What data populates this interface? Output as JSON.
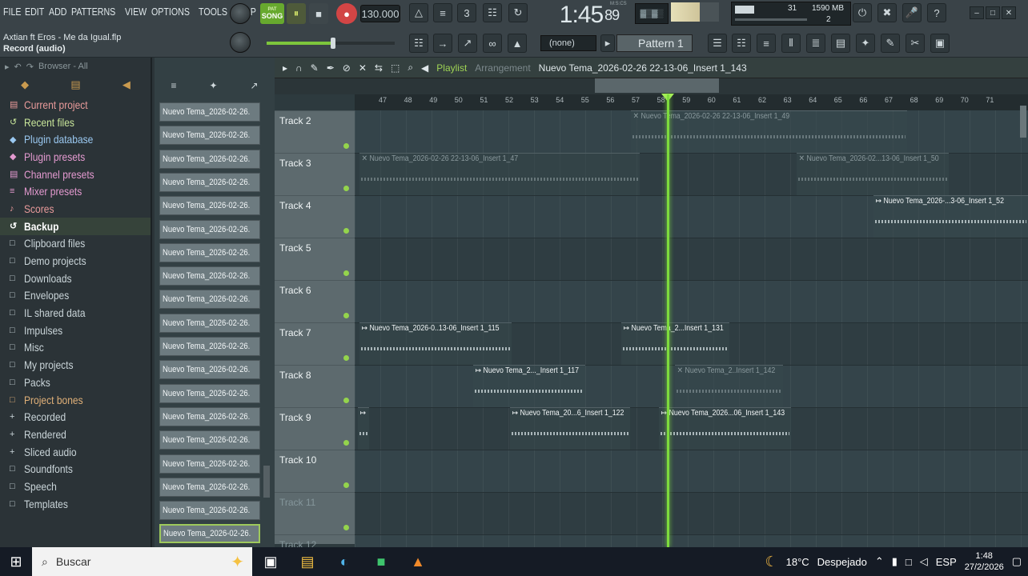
{
  "menu": [
    "FILE",
    "EDIT",
    "ADD",
    "PATTERNS",
    "VIEW",
    "OPTIONS",
    "TOOLS",
    "HELP"
  ],
  "song": {
    "file": "Axtian ft Eros - Me da Igual.flp",
    "hint": "Record (audio)"
  },
  "transport": {
    "mode_label": "SONG",
    "play_icon": "⏸",
    "stop_icon": "■",
    "tempo": "130.000",
    "time": "1:45",
    "time_sub": "89",
    "time_format": "M:S:CS"
  },
  "cpu": {
    "voices": "31",
    "memory": "1590 MB",
    "polyphony": "2"
  },
  "pattern": {
    "none": "(none)",
    "current": "Pattern 1"
  },
  "browser": {
    "title": "Browser - All",
    "items": [
      {
        "icon": "▤",
        "label": "Current project",
        "color": "#e89a9a"
      },
      {
        "icon": "↺",
        "label": "Recent files",
        "color": "#c8e69a"
      },
      {
        "icon": "◆",
        "label": "Plugin database",
        "color": "#9ac8f0"
      },
      {
        "icon": "◆",
        "label": "Plugin presets",
        "color": "#e49ad0"
      },
      {
        "icon": "▤",
        "label": "Channel presets",
        "color": "#e49ad0"
      },
      {
        "icon": "≡",
        "label": "Mixer presets",
        "color": "#e49ad0"
      },
      {
        "icon": "♪",
        "label": "Scores",
        "color": "#e89a9a"
      },
      {
        "icon": "↺",
        "label": "Backup",
        "color": "#c8e69a"
      },
      {
        "icon": "□",
        "label": "Clipboard files",
        "color": "#c9d4d8"
      },
      {
        "icon": "□",
        "label": "Demo projects",
        "color": "#c9d4d8"
      },
      {
        "icon": "□",
        "label": "Downloads",
        "color": "#c9d4d8"
      },
      {
        "icon": "□",
        "label": "Envelopes",
        "color": "#c9d4d8"
      },
      {
        "icon": "□",
        "label": "IL shared data",
        "color": "#c9d4d8"
      },
      {
        "icon": "□",
        "label": "Impulses",
        "color": "#c9d4d8"
      },
      {
        "icon": "□",
        "label": "Misc",
        "color": "#c9d4d8"
      },
      {
        "icon": "□",
        "label": "My projects",
        "color": "#c9d4d8"
      },
      {
        "icon": "□",
        "label": "Packs",
        "color": "#c9d4d8"
      },
      {
        "icon": "□",
        "label": "Project bones",
        "color": "#e0b078"
      },
      {
        "icon": "+",
        "label": "Recorded",
        "color": "#c9d4d8"
      },
      {
        "icon": "+",
        "label": "Rendered",
        "color": "#c9d4d8"
      },
      {
        "icon": "+",
        "label": "Sliced audio",
        "color": "#c9d4d8"
      },
      {
        "icon": "□",
        "label": "Soundfonts",
        "color": "#c9d4d8"
      },
      {
        "icon": "□",
        "label": "Speech",
        "color": "#c9d4d8"
      },
      {
        "icon": "□",
        "label": "Templates",
        "color": "#c9d4d8"
      }
    ],
    "selected": "Backup"
  },
  "clip_list": [
    "Nuevo Tema_2026-02-26.",
    "Nuevo Tema_2026-02-26.",
    "Nuevo Tema_2026-02-26.",
    "Nuevo Tema_2026-02-26.",
    "Nuevo Tema_2026-02-26.",
    "Nuevo Tema_2026-02-26.",
    "Nuevo Tema_2026-02-26.",
    "Nuevo Tema_2026-02-26.",
    "Nuevo Tema_2026-02-26.",
    "Nuevo Tema_2026-02-26.",
    "Nuevo Tema_2026-02-26.",
    "Nuevo Tema_2026-02-26.",
    "Nuevo Tema_2026-02-26.",
    "Nuevo Tema_2026-02-26.",
    "Nuevo Tema_2026-02-26.",
    "Nuevo Tema_2026-02-26.",
    "Nuevo Tema_2026-02-26.",
    "Nuevo Tema_2026-02-26.",
    "Nuevo Tema_2026-02-26."
  ],
  "playlist": {
    "title": "Playlist",
    "subtitle": "Arrangement",
    "clip_name": "Nuevo Tema_2026-02-26 22-13-06_Insert 1_143",
    "ruler": [
      "47",
      "48",
      "49",
      "50",
      "51",
      "52",
      "53",
      "54",
      "55",
      "56",
      "57",
      "58",
      "59",
      "60",
      "61",
      "62",
      "63",
      "64",
      "65",
      "66",
      "67",
      "68",
      "69",
      "70",
      "71"
    ],
    "tracks": [
      "Track 2",
      "Track 3",
      "Track 4",
      "Track 5",
      "Track 6",
      "Track 7",
      "Track 8",
      "Track 9",
      "Track 10",
      "Track 11",
      "Track 12"
    ],
    "clips": [
      {
        "track": "Track 2",
        "label": "✕ Nuevo Tema_2026-02-26 22-13-06_Insert 1_49",
        "muted": true
      },
      {
        "track": "Track 3",
        "label": "✕ Nuevo Tema_2026-02-26 22-13-06_Insert 1_47",
        "muted": true
      },
      {
        "track": "Track 3",
        "label": "✕ Nuevo Tema_2026-02...13-06_Insert 1_50",
        "muted": true
      },
      {
        "track": "Track 4",
        "label": "↦ Nuevo Tema_2026-...3-06_Insert 1_52",
        "muted": false
      },
      {
        "track": "Track 7",
        "label": "↦ Nuevo Tema_2026-0..13-06_Insert 1_115",
        "muted": false
      },
      {
        "track": "Track 7",
        "label": "↦ Nuevo Tema_2...Insert 1_131",
        "muted": false
      },
      {
        "track": "Track 8",
        "label": "↦ Nuevo Tema_2..._Insert 1_117",
        "muted": false
      },
      {
        "track": "Track 8",
        "label": "✕ Nuevo Tema_2..Insert 1_142",
        "muted": true
      },
      {
        "track": "Track 9",
        "label": "↦",
        "muted": false
      },
      {
        "track": "Track 9",
        "label": "↦ Nuevo Tema_20...6_Insert 1_122",
        "muted": false
      },
      {
        "track": "Track 9",
        "label": "↦ Nuevo Tema_2026...06_Insert 1_143",
        "muted": false
      }
    ]
  },
  "taskbar": {
    "search": "Buscar",
    "weather": "18°C",
    "weather_text": "Despejado",
    "lang": "ESP",
    "time": "1:48",
    "date": "27/2/2026"
  }
}
